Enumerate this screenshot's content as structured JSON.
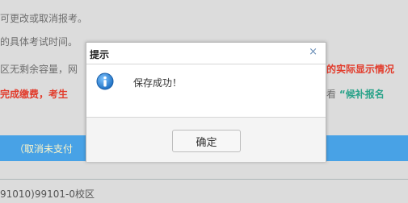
{
  "background": {
    "line1": "可更改或取消报考。",
    "line2": "的具体考试时间。",
    "line3_left": "区无剩余容量，网",
    "line3_right": "的实际显示情况",
    "line4_left": "完成缴费，考生",
    "line4_right_gray": "看",
    "line4_right_green": "“候补报名",
    "bar_text": "（取消未支付",
    "campus_text": "91010)99101-0校区"
  },
  "dialog": {
    "title": "提示",
    "close_glyph": "×",
    "icon": "info-icon",
    "message": "保存成功！",
    "ok_label": "确定"
  },
  "colors": {
    "accent_blue": "#48a2e6",
    "warning_red": "#e23b2b",
    "link_green": "#2aa38a"
  }
}
